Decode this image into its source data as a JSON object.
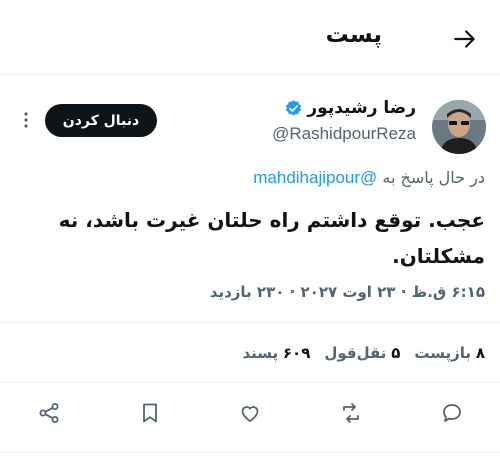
{
  "header": {
    "title": "پست",
    "back_icon": "arrow-right-icon"
  },
  "author": {
    "name": "رضا رشیدپور",
    "handle": "@RashidpourReza",
    "verified_color": "#1d9bf0"
  },
  "follow_label": "دنبال کردن",
  "reply_prefix": "در حال پاسخ به",
  "reply_mention": "@mahdihajipour",
  "tweet_text": "عجب. توقع داشتم راه حلتان غیرت باشد، نه مشکلتان.",
  "meta": "۶:۱۵ ق.ظ · ۲۳ اوت ۲۰۲۷ · ۲۳۰ بازدید",
  "stats": {
    "retweets_count": "۸",
    "retweets_label": "بازپست",
    "quotes_count": "۵",
    "quotes_label": "نقل‌قول",
    "likes_count": "۶۰۹",
    "likes_label": "پسند"
  },
  "actions": [
    "reply-icon",
    "repost-icon",
    "like-icon",
    "bookmark-icon",
    "share-icon"
  ]
}
